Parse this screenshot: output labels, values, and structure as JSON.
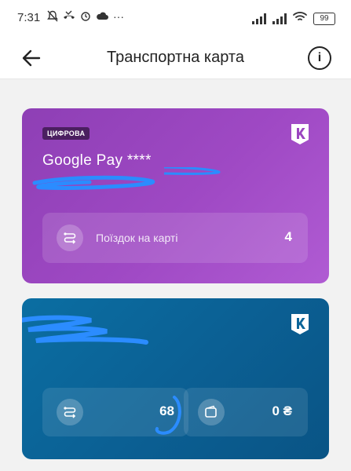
{
  "status_bar": {
    "time": "7:31",
    "dots": "···",
    "battery": "99"
  },
  "app_bar": {
    "title": "Транспортна карта"
  },
  "card1": {
    "badge": "ЦИФРОВА",
    "name": "Google Pay ****",
    "trips_label": "Поїздок на карті",
    "trips_value": "4",
    "color": "#9b46c0"
  },
  "card2": {
    "trips_value": "68",
    "balance_value": "0 ₴",
    "color": "#0b6599"
  }
}
